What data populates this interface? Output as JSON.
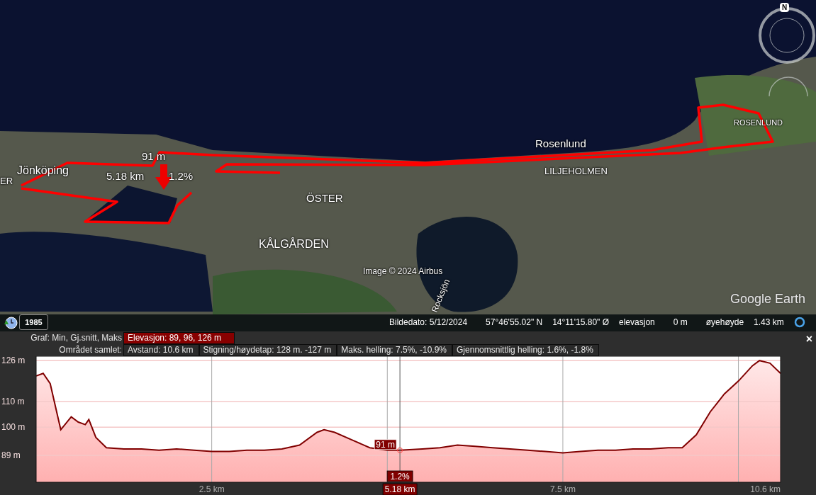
{
  "map": {
    "labels": [
      "ER",
      "Jönköping",
      "ÖSTER",
      "KÅLGÅRDEN",
      "LILJEHOLMEN",
      "Rosenlund",
      "ROSENLUND",
      "Rocksjön"
    ],
    "route_marker": {
      "elevation": "91 m",
      "distance": "5.18 km",
      "grade": "1.2%"
    },
    "compass": {
      "north": "N"
    },
    "attribution": "Image © 2024 Airbus",
    "logo": "Google Earth",
    "historical_imagery": {
      "year": "1985"
    },
    "status_bar": {
      "image_date": "Bildedato: 5/12/2024",
      "latitude": "57°46'55.02\" N",
      "longitude": "14°11'15.80\" Ø",
      "elevation_label": "elevasjon",
      "elevation": "0 m",
      "eye_altitude_label": "øyehøyde",
      "eye_altitude": "1.43 km"
    }
  },
  "profile": {
    "close": "×",
    "graph_label": "Graf: Min, Gj.snitt, Maks",
    "elevation": "Elevasjon: 89, 96, 126 m",
    "summary_label": "Området samlet:",
    "summary": [
      "Avstand: 10.6 km",
      "Stigning/høydetap: 128 m. -127 m",
      "Maks. helling: 7.5%, -10.9%",
      "Gjennomsnittlig helling: 1.6%, -1.8%"
    ],
    "chart_data": {
      "type": "area",
      "grid": true,
      "ref_lines": [
        {
          "axis": "x",
          "value": 5.18,
          "label": "5.18 km"
        }
      ],
      "annotations": [
        {
          "x": 5.18,
          "y": 91,
          "text": "91 m"
        },
        {
          "x": 5.18,
          "text": "1.2%"
        }
      ],
      "x": [
        0,
        0.1,
        0.2,
        0.35,
        0.5,
        0.6,
        0.7,
        0.75,
        0.85,
        1.0,
        1.25,
        1.5,
        1.75,
        2.0,
        2.25,
        2.5,
        2.75,
        3.0,
        3.25,
        3.5,
        3.75,
        4.0,
        4.1,
        4.25,
        4.5,
        4.75,
        5.0,
        5.18,
        5.5,
        5.75,
        6.0,
        6.25,
        6.5,
        6.75,
        7.0,
        7.25,
        7.5,
        7.75,
        8.0,
        8.25,
        8.5,
        8.75,
        9.0,
        9.2,
        9.4,
        9.6,
        9.8,
        10.0,
        10.2,
        10.3,
        10.45,
        10.6
      ],
      "series": [
        {
          "color": "#800000",
          "values": [
            120,
            121,
            117,
            99,
            104,
            102,
            101,
            103,
            96,
            92,
            91.5,
            91.5,
            91,
            91.5,
            91,
            90.5,
            90.5,
            91,
            91,
            91.5,
            93,
            98,
            99,
            98,
            95,
            92,
            91,
            91,
            91.5,
            92,
            93,
            92.5,
            92,
            91.5,
            91,
            90.5,
            90,
            90.5,
            91,
            91,
            91.5,
            91.5,
            92,
            92,
            97,
            106,
            113,
            118,
            124,
            126,
            125,
            121
          ]
        }
      ],
      "xlim": [
        0,
        10.6
      ],
      "ylim": [
        78.5,
        127.7
      ],
      "xticks": [
        {
          "value": 2.5,
          "label": "2.5 km"
        },
        {
          "value": 7.5,
          "label": "7.5 km"
        },
        {
          "value": 10.6,
          "label": "10.6 km"
        }
      ],
      "yticks": [
        {
          "value": 89,
          "label": "89 m"
        },
        {
          "value": 100,
          "label": "100 m"
        },
        {
          "value": 110,
          "label": "110 m"
        },
        {
          "value": 126,
          "label": "126 m"
        }
      ]
    }
  }
}
